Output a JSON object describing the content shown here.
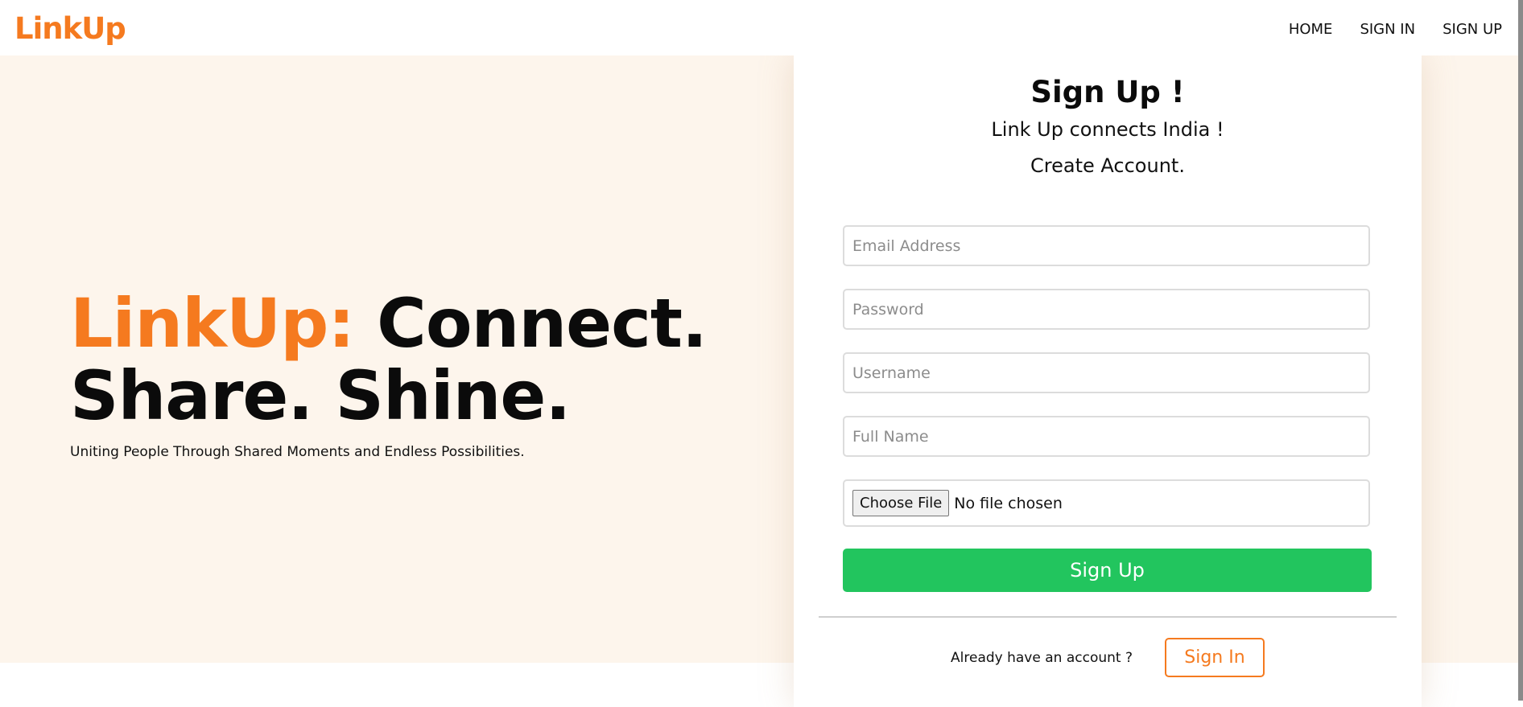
{
  "nav": {
    "brand": "LinkUp",
    "links": [
      "HOME",
      "SIGN IN",
      "SIGN UP"
    ]
  },
  "hero": {
    "title_accent": "LinkUp:",
    "title_line1": "Connect.",
    "title_line2": "Share. Shine.",
    "subtitle": "Uniting People Through Shared Moments and Endless Possibilities."
  },
  "form": {
    "title": "Sign Up !",
    "tagline": "Link Up connects India !",
    "subtitle": "Create Account.",
    "email_placeholder": "Email Address",
    "password_placeholder": "Password",
    "username_placeholder": "Username",
    "fullname_placeholder": "Full Name",
    "file_button": "Choose File",
    "file_status": "No file chosen",
    "submit_label": "Sign Up",
    "signin_prompt": "Already have an account ?",
    "signin_label": "Sign In"
  },
  "colors": {
    "accent": "#f57a1f",
    "success": "#22c55e",
    "hero_bg": "#fdf5ec"
  }
}
